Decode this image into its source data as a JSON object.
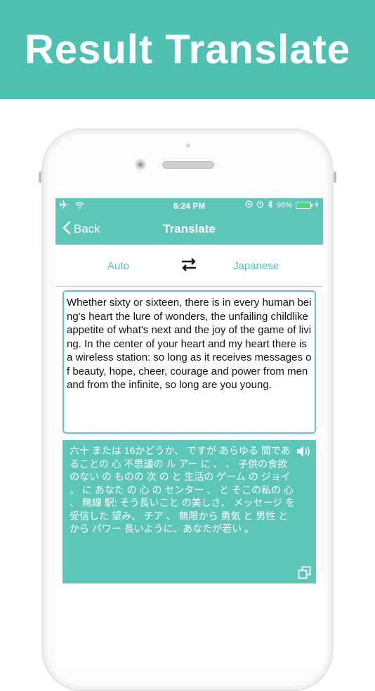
{
  "banner": {
    "title": "Result Translate"
  },
  "status": {
    "time": "6:24 PM",
    "battery": "98%",
    "icons": [
      "airplane-icon",
      "wifi-icon",
      "lock-rotation-icon",
      "alarm-icon",
      "bluetooth-icon",
      "battery-icon",
      "charging-icon"
    ]
  },
  "nav": {
    "back_label": "Back",
    "title": "Translate"
  },
  "languages": {
    "source": "Auto",
    "target": "Japanese",
    "swap_icon": "swap-arrows-icon"
  },
  "input": {
    "text": "Whether sixty or sixteen, there is in every human being's heart the lure of wonders, the unfailing childlike appetite of what's next and the joy of the game of living. In the center of your heart and my heart there is a wireless station: so long as it receives messages of beauty, hope, cheer, courage and power from men and from the infinite, so long are you young."
  },
  "output": {
    "text": "六十 または 16かどうか、 ですが あらゆる 間であることの 心 不思議の ル アー に 、 、 子供の食欲のない の ものの 次 の と 生活の ゲーム の ジョイ 。 に あなた の 心 の センター 、 と そこの私の 心 、 無線 駅: そう長いこと の美しさ、 メッセージ を受信した 望み、 チア 、 無限から 勇気 と 男性 と から パワー 長いように、あなたが若い 。",
    "speaker_icon": "speaker-icon",
    "copy_icon": "copy-icon"
  },
  "colors": {
    "accent": "#4fc1b3",
    "bar": "#5cc6b9",
    "battery_fill": "#4cd964"
  }
}
